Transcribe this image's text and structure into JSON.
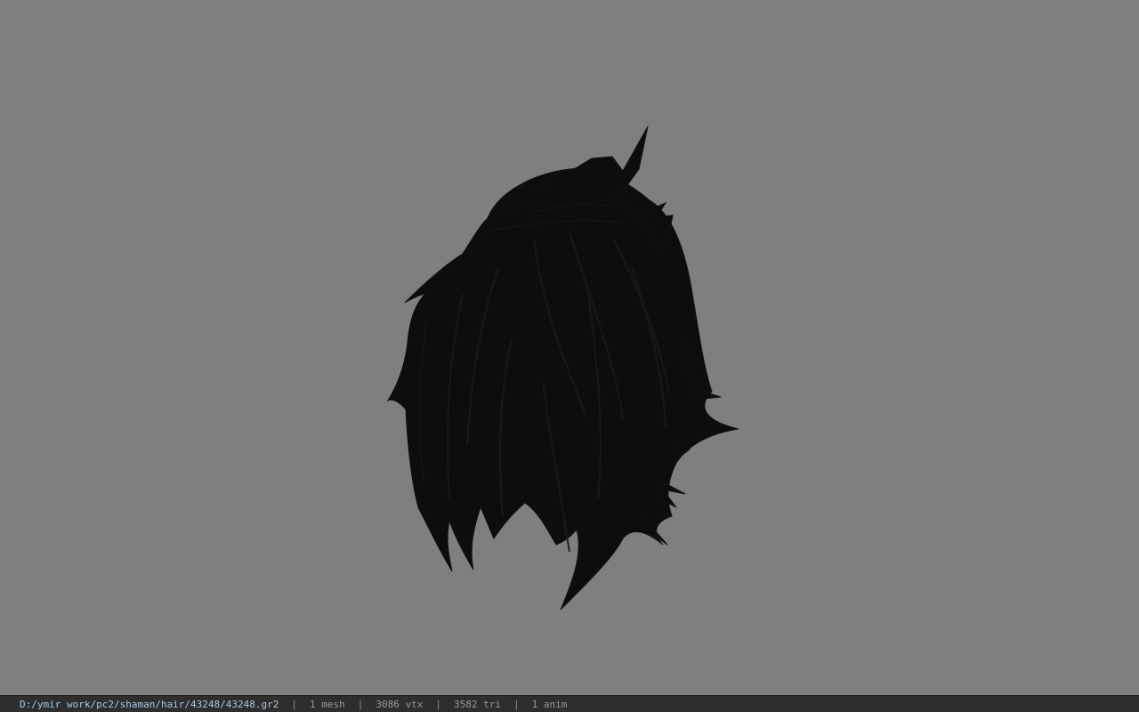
{
  "viewport": {
    "background_color": "#7f7f7f",
    "model_color": "#0d0d0d",
    "model_icon": "hair-mesh-icon"
  },
  "statusbar": {
    "file_path": "D:/ymir work/pc2/shaman/hair/43248/43248.gr2",
    "separator": "|",
    "mesh": "1 mesh",
    "vertices": "3086 vtx",
    "triangles": "3582 tri",
    "animations": "1 anim",
    "path_color": "#a9c8e6",
    "background_color": "#2e2e2e"
  }
}
